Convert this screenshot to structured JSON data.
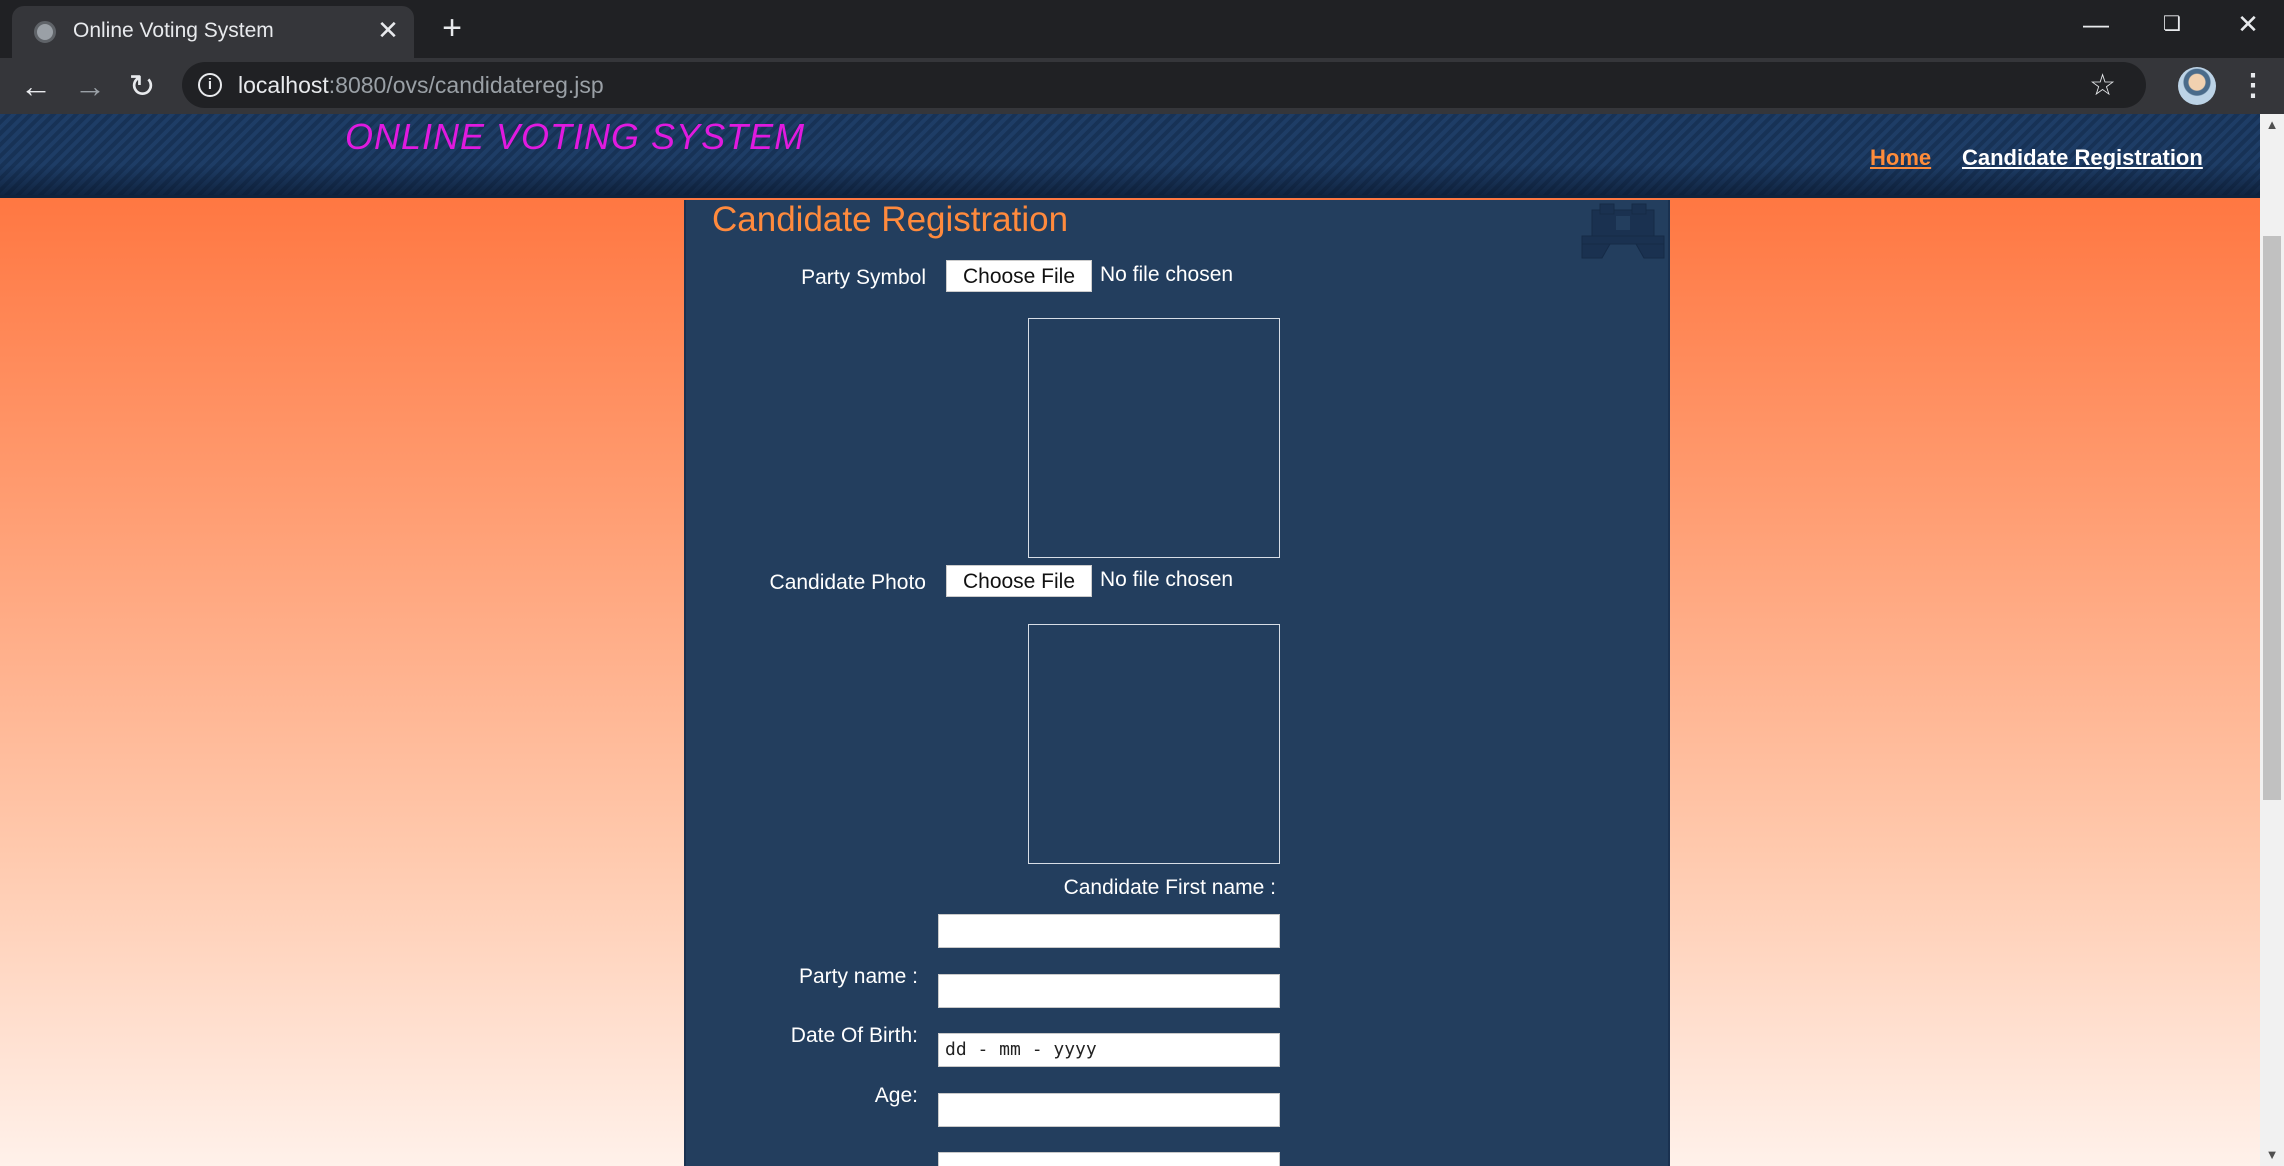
{
  "browser": {
    "tab_title": "Online Voting System",
    "url_host": "localhost",
    "url_path": ":8080/ovs/candidatereg.jsp"
  },
  "site": {
    "title": "ONLINE VOTING SYSTEM",
    "nav": {
      "home": "Home",
      "candidate_registration": "Candidate Registration"
    }
  },
  "form": {
    "heading": "Candidate Registration",
    "party_symbol": {
      "label": "Party Symbol",
      "button": "Choose File",
      "status": "No file chosen"
    },
    "candidate_photo": {
      "label": "Candidate Photo",
      "button": "Choose File",
      "status": "No file chosen"
    },
    "first_name": {
      "label": "Candidate First name :",
      "value": ""
    },
    "party_name": {
      "label": "Party name :",
      "value": ""
    },
    "dob": {
      "label": "Date Of Birth:",
      "placeholder": "dd - mm - yyyy"
    },
    "age": {
      "label": "Age:",
      "value": ""
    }
  },
  "colors": {
    "accent_orange": "#ff8a3d",
    "title_magenta": "#e01adf",
    "panel_blue": "#233e5e"
  }
}
